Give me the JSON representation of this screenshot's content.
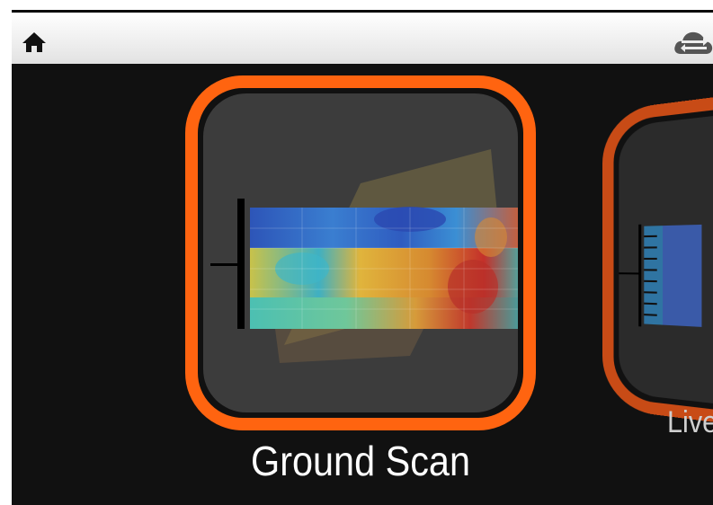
{
  "toolbar": {
    "home_icon": "home-icon",
    "right_icon": "cloud-sync-icon"
  },
  "tiles": [
    {
      "label": "Ground Scan",
      "selected": true,
      "accent": "#ff6410"
    },
    {
      "label": "Live",
      "selected": false,
      "accent": "#c84b16"
    }
  ]
}
